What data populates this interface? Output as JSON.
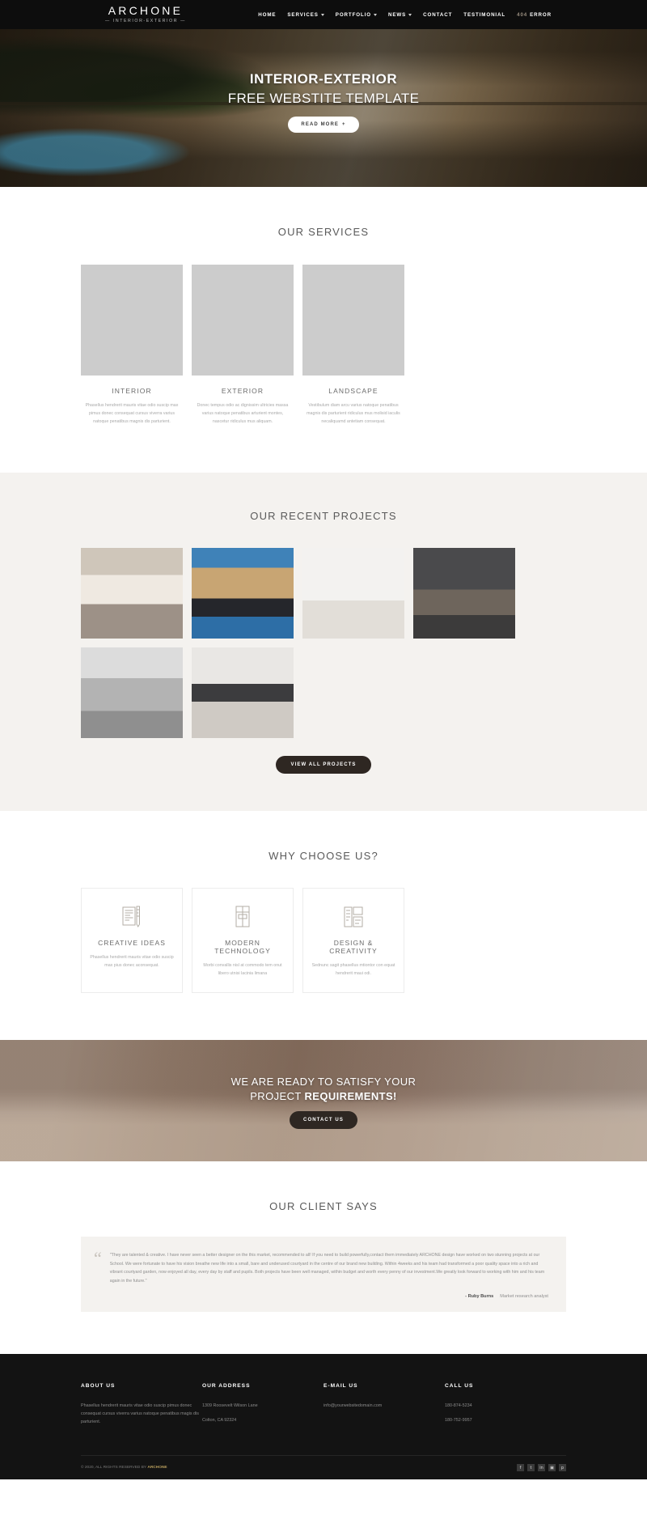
{
  "header": {
    "brand_name": "ARCHONE",
    "brand_sub": "— INTERIOR-EXTERIOR —",
    "nav": [
      {
        "label": "HOME",
        "caret": false
      },
      {
        "label": "SERVICES",
        "caret": true
      },
      {
        "label": "PORTFOLIO",
        "caret": true
      },
      {
        "label": "NEWS",
        "caret": true
      },
      {
        "label": "CONTACT",
        "caret": false
      },
      {
        "label": "TESTIMONIAL",
        "caret": false
      }
    ],
    "error_num": "404",
    "error_label": "ERROR"
  },
  "hero": {
    "title_1": "INTERIOR-EXTERIOR",
    "title_2": "FREE WEBSTITE TEMPLATE",
    "button": "READ MORE",
    "button_icon": "+"
  },
  "services": {
    "title": "OUR SERVICES",
    "items": [
      {
        "image": "kitchen-interior-photo",
        "name": "INTERIOR",
        "desc": "Phasellus hendrerit mauris vitae odio suscip max pimus donec consequat cursus viverra varius natoque penatibus magnis dis parturient."
      },
      {
        "image": "modern-house-exterior-photo",
        "name": "EXTERIOR",
        "desc": "Donec tempus odio ac dignissim ultricies massa varius natoque penatibus arturient montes, nascetur ridiculus mus aliquam."
      },
      {
        "image": "landscape-terrace-photo",
        "name": "LANDSCAPE",
        "desc": "Vestibulum diam arcu varius natoque penatibus magnis dis parturient ridiculus mus molisid iaculis necaliquamd antetiam consequat."
      }
    ]
  },
  "projects": {
    "title": "OUR RECENT PROJECTS",
    "items": [
      {
        "image": "living-room-photo"
      },
      {
        "image": "night-villa-pool-photo"
      },
      {
        "image": "white-shelf-chair-photo"
      },
      {
        "image": "dark-bathroom-photo"
      },
      {
        "image": "grey-sofa-photo"
      },
      {
        "image": "modern-kitchen-photo"
      }
    ],
    "button": "VIEW ALL PROJECTS"
  },
  "why": {
    "title": "WHY CHOOSE US?",
    "items": [
      {
        "icon": "blueprint-ruler-icon",
        "name": "CREATIVE IDEAS",
        "desc": "Phasellus hendrerit mauris vitae odio suscip max pius donec aconsequat."
      },
      {
        "icon": "window-frame-icon",
        "name": "MODERN TECHNOLOGY",
        "desc": "Morbi convallis nisl at commodo tem onut libero utnisi lacinia limana"
      },
      {
        "icon": "building-plan-icon",
        "name": "DESIGN & CREATIVITY",
        "desc": "Sednunc sagit phasellus mtiontor con equat hendrerit maui odi."
      }
    ]
  },
  "cta": {
    "line_1": "WE ARE READY TO SATISFY YOUR",
    "line_2_normal": "PROJECT ",
    "line_2_bold": "REQUIREMENTS!",
    "button": "CONTACT US"
  },
  "testimonial": {
    "title": "OUR CLIENT SAYS",
    "quote_mark": "“",
    "quote": "\"They are talented & creative. I have never seen a better designer on the this market, recommended to all! If you need to build powerfully,contact them immediately ARCHONE design have worked on two stunning projects at our School. We were fortunate to have his vision breathe new life into a small, bare and underused courtyard in the centre of our brand new building. Within 4weeks and his team had transformed a poor quality space into a rich and vibrant courtyard garden, now enjoyed all day, every day by staff and pupils. Both projects have been well managed, within budget and worth every penny of our investment.We greatly look forward to working with him and his team again in the future.\"",
    "author": "- Ruby Burns",
    "author_role": "Market research analyst"
  },
  "footer": {
    "columns": [
      {
        "title": "ABOUT US",
        "lines": [
          "Phasellus hendrerit mauris vitae odio suscip pimus donec consequat cursus viverra varius natoque penatibus magis dis parturient."
        ]
      },
      {
        "title": "OUR ADDRESS",
        "lines": [
          "1309 Roosevelt Wilson Lane",
          "Colton, CA 92324"
        ]
      },
      {
        "title": "E-MAIL US",
        "lines": [
          "info@yourwebsitedomain.com"
        ]
      },
      {
        "title": "CALL US",
        "lines": [
          "180-874-5234",
          "180-752-9957"
        ]
      }
    ],
    "copyright_prefix": "© 2020, ALL RIGHTS RESERVED BY ",
    "copyright_brand": "ARCHONE",
    "socials": [
      {
        "icon": "facebook-icon",
        "glyph": "f"
      },
      {
        "icon": "twitter-icon",
        "glyph": "t"
      },
      {
        "icon": "linkedin-icon",
        "glyph": "in"
      },
      {
        "icon": "instagram-icon",
        "glyph": "▣"
      },
      {
        "icon": "pinterest-icon",
        "glyph": "p"
      }
    ]
  }
}
